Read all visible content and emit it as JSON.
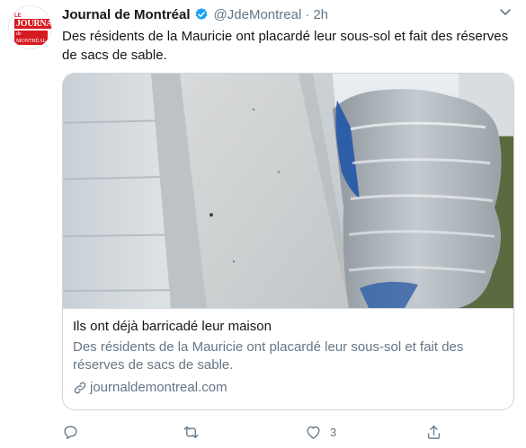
{
  "account": {
    "logo_top": "LE",
    "logo_main": "JOURNAL",
    "logo_sub": "de MONTRÉAL",
    "display_name": "Journal de Montréal",
    "handle": "@JdeMontreal",
    "separator": "·",
    "timestamp": "2h",
    "verified": true
  },
  "tweet": {
    "text": "Des résidents de la Mauricie ont placardé leur sous-sol et fait des réserves de sacs de sable."
  },
  "card": {
    "title": "Ils ont déjà barricadé leur maison",
    "description": "Des résidents de la Mauricie ont placardé leur sous-sol et fait des réserves de sacs de sable.",
    "domain": "journaldemontreal.com"
  },
  "actions": {
    "reply_count": "",
    "retweet_count": "",
    "like_count": "3",
    "icons": [
      "reply-icon",
      "retweet-icon",
      "like-icon",
      "share-icon"
    ]
  },
  "colors": {
    "text": "#14171a",
    "secondary": "#657786",
    "verified": "#1da1f2",
    "border": "#ccd6dd",
    "brand_red": "#d71920"
  }
}
